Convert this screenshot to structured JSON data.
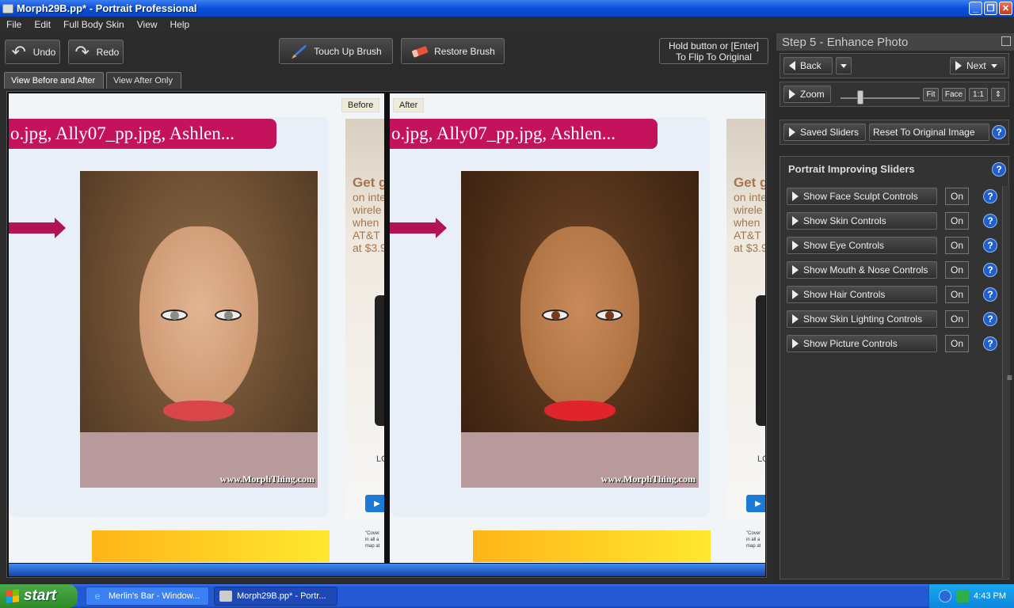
{
  "window": {
    "title": "Morph29B.pp* - Portrait Professional"
  },
  "menu": [
    "File",
    "Edit",
    "Full Body Skin",
    "View",
    "Help"
  ],
  "toolbar": {
    "undo": "Undo",
    "redo": "Redo",
    "touch_up": "Touch Up Brush",
    "restore": "Restore Brush",
    "flip_note_line1": "Hold button or [Enter]",
    "flip_note_line2": "To Flip To Original"
  },
  "tabs": {
    "before_after": "View Before and After",
    "after_only": "View After Only"
  },
  "viewer": {
    "before_label": "Before",
    "after_label": "After",
    "banner_text": "o.jpg, Ally07_pp.jpg, Ashlen...",
    "watermark": "www.MorphThing.com",
    "ad_headline": "Get g",
    "ad_lines": [
      "on inte",
      "wirele",
      "when",
      "AT&T",
      "at $3.9"
    ],
    "ad_logo": "LO",
    "ad_small_lines": [
      "\"Cover",
      "in all a",
      "map at"
    ],
    "ad_button": "▶"
  },
  "panel": {
    "step_title": "Step 5 - Enhance Photo",
    "back": "Back",
    "next": "Next",
    "zoom": "Zoom",
    "zoom_fit": "Fit",
    "zoom_face": "Face",
    "zoom_one": "1:1",
    "saved_sliders": "Saved Sliders",
    "reset": "Reset To Original Image",
    "sliders_title": "Portrait Improving Sliders",
    "sliders": [
      {
        "label": "Show Face Sculpt Controls",
        "state": "On"
      },
      {
        "label": "Show Skin Controls",
        "state": "On"
      },
      {
        "label": "Show Eye Controls",
        "state": "On"
      },
      {
        "label": "Show Mouth & Nose Controls",
        "state": "On"
      },
      {
        "label": "Show Hair Controls",
        "state": "On"
      },
      {
        "label": "Show Skin Lighting Controls",
        "state": "On"
      },
      {
        "label": "Show Picture Controls",
        "state": "On"
      }
    ],
    "help_glyph": "?"
  },
  "taskbar": {
    "start": "start",
    "tasks": [
      "Merlin's Bar - Window...",
      "Morph29B.pp* - Portr..."
    ],
    "clock": "4:43 PM"
  },
  "colors": {
    "accent_blue": "#0a4fd8",
    "banner_pink": "#c4135c",
    "panel_bg": "#2a2a2a"
  }
}
